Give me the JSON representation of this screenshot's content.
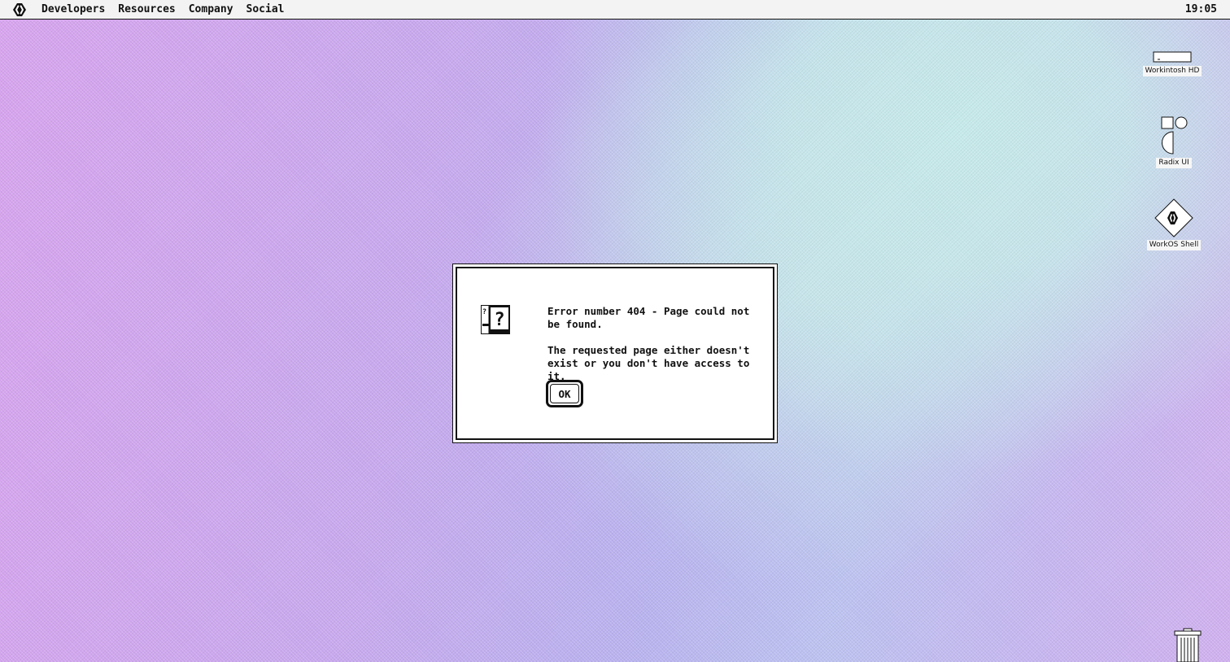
{
  "menubar": {
    "logo_icon": "workos-logo-icon",
    "items": [
      {
        "label": "Developers"
      },
      {
        "label": "Resources"
      },
      {
        "label": "Company"
      },
      {
        "label": "Social"
      }
    ],
    "clock": "19:05"
  },
  "desktop": {
    "icons": [
      {
        "label": "Workintosh HD",
        "icon": "hard-drive-icon"
      },
      {
        "label": "Radix UI",
        "icon": "radix-icon"
      },
      {
        "label": "WorkOS Shell",
        "icon": "workos-diamond-icon"
      }
    ],
    "trash_icon": "trash-icon"
  },
  "dialog": {
    "icon": "alert-question-icon",
    "line1": "Error number 404 - Page could not be found.",
    "line2": "The requested page either doesn't exist or you don't have access to it.",
    "ok_label": "OK"
  },
  "colors": {
    "background_left": "#d7a3ee",
    "background_right": "#c6eaea",
    "menubar": "#f3f3f3",
    "ink": "#111111"
  }
}
